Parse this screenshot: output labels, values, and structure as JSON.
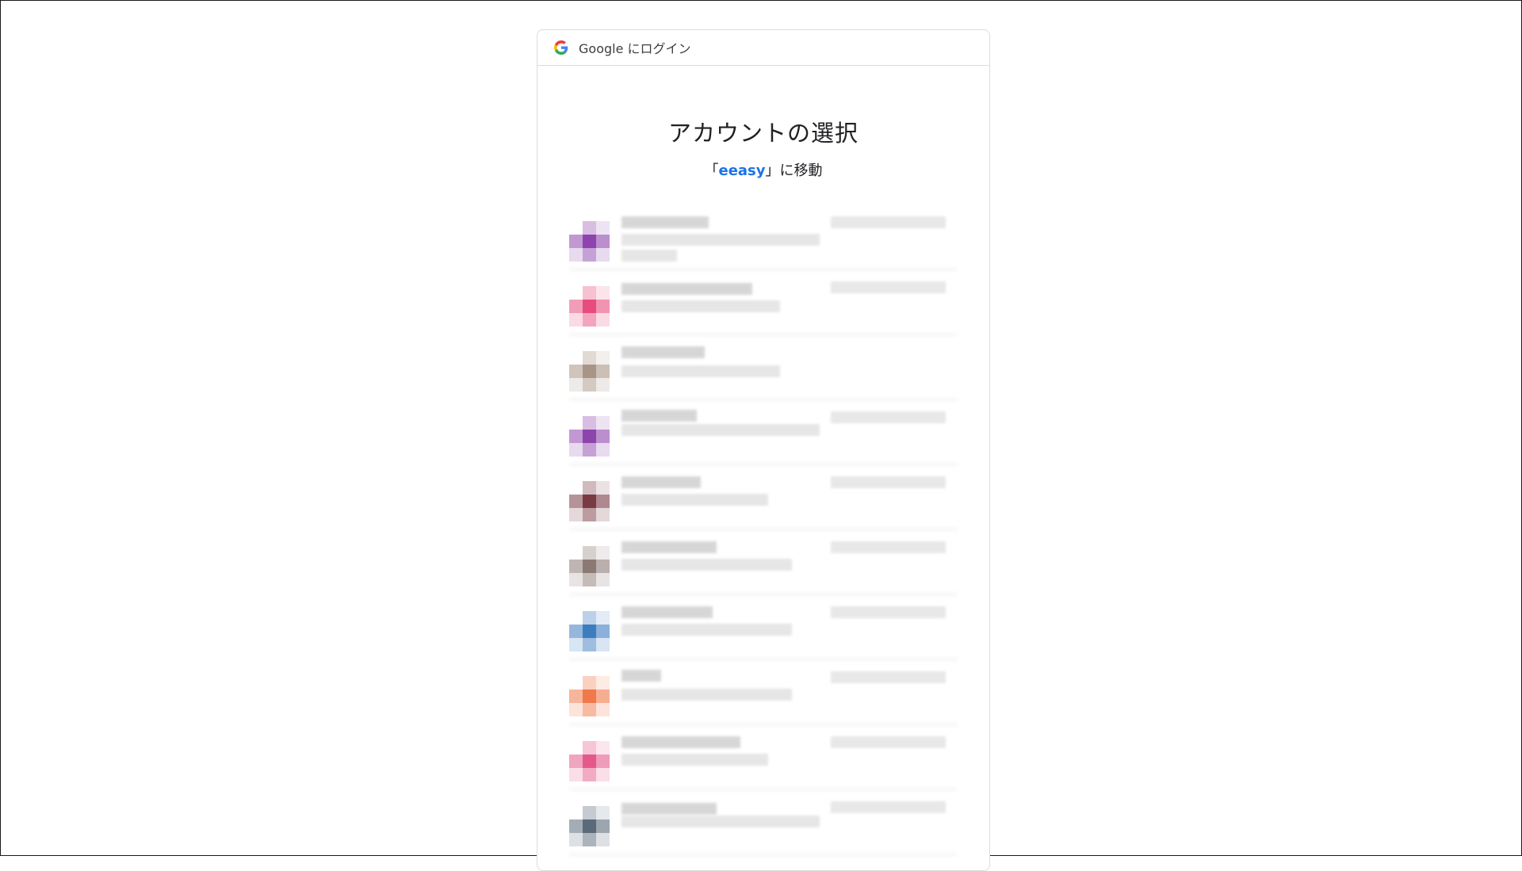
{
  "header": {
    "title": "Google にログイン"
  },
  "main": {
    "title": "アカウントの選択",
    "subtitle_prefix": "「",
    "app_name": "eeasy",
    "subtitle_suffix": "」に移動"
  },
  "accounts": [
    {
      "avatar_color": "#8e44ad"
    },
    {
      "avatar_color": "#e84c7d"
    },
    {
      "avatar_color": "#a89585"
    },
    {
      "avatar_color": "#8e44ad"
    },
    {
      "avatar_color": "#7a3a44"
    },
    {
      "avatar_color": "#8b7a74"
    },
    {
      "avatar_color": "#3e7cc0"
    },
    {
      "avatar_color": "#f0784a"
    },
    {
      "avatar_color": "#e4598a"
    },
    {
      "avatar_color": "#5a6a78"
    }
  ],
  "colors": {
    "accent": "#1a73e8",
    "border": "#dadce0"
  }
}
